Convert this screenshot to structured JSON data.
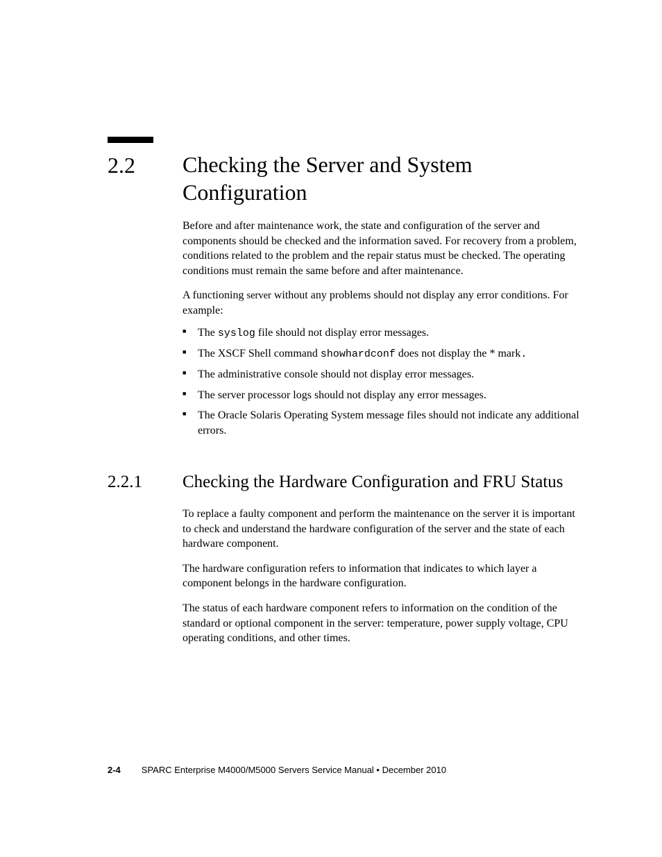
{
  "section": {
    "number": "2.2",
    "title": "Checking the Server and System Configuration",
    "para1": "Before and after maintenance work, the state and configuration of the server and components should be checked and the information saved. For recovery from a problem, conditions related to the problem and the repair status must be checked. The operating conditions must remain the same before and after maintenance.",
    "para2_pre": "A functioning ",
    "para2_server": "server",
    "para2_post": " without any problems should not display any error conditions. For example:",
    "bullets": {
      "b1_pre": "The ",
      "b1_mono": "syslog",
      "b1_post": " file should not display error messages.",
      "b2_pre": "The XSCF Shell command ",
      "b2_mono": "showhardconf",
      "b2_post": " does not display the * mark",
      "b2_dot": ".",
      "b3": "The administrative console should not display error messages.",
      "b4": "The server processor logs should not display any error messages.",
      "b5": "The Oracle Solaris Operating System message files should not indicate any additional errors."
    }
  },
  "subsection": {
    "number": "2.2.1",
    "title": "Checking the Hardware Configuration and FRU Status",
    "para1": "To replace a faulty component and perform the maintenance on the server it is important to check and understand the hardware configuration of the server and the state of each hardware component.",
    "para2": "The hardware configuration refers to information that indicates to which layer a component belongs in the hardware configuration.",
    "para3": "The status of each hardware component refers to information on the condition of the standard or optional component in the server: temperature, power supply voltage, CPU operating conditions, and other times."
  },
  "footer": {
    "pageno": "2-4",
    "text": "SPARC Enterprise M4000/M5000 Servers Service Manual • December 2010"
  }
}
